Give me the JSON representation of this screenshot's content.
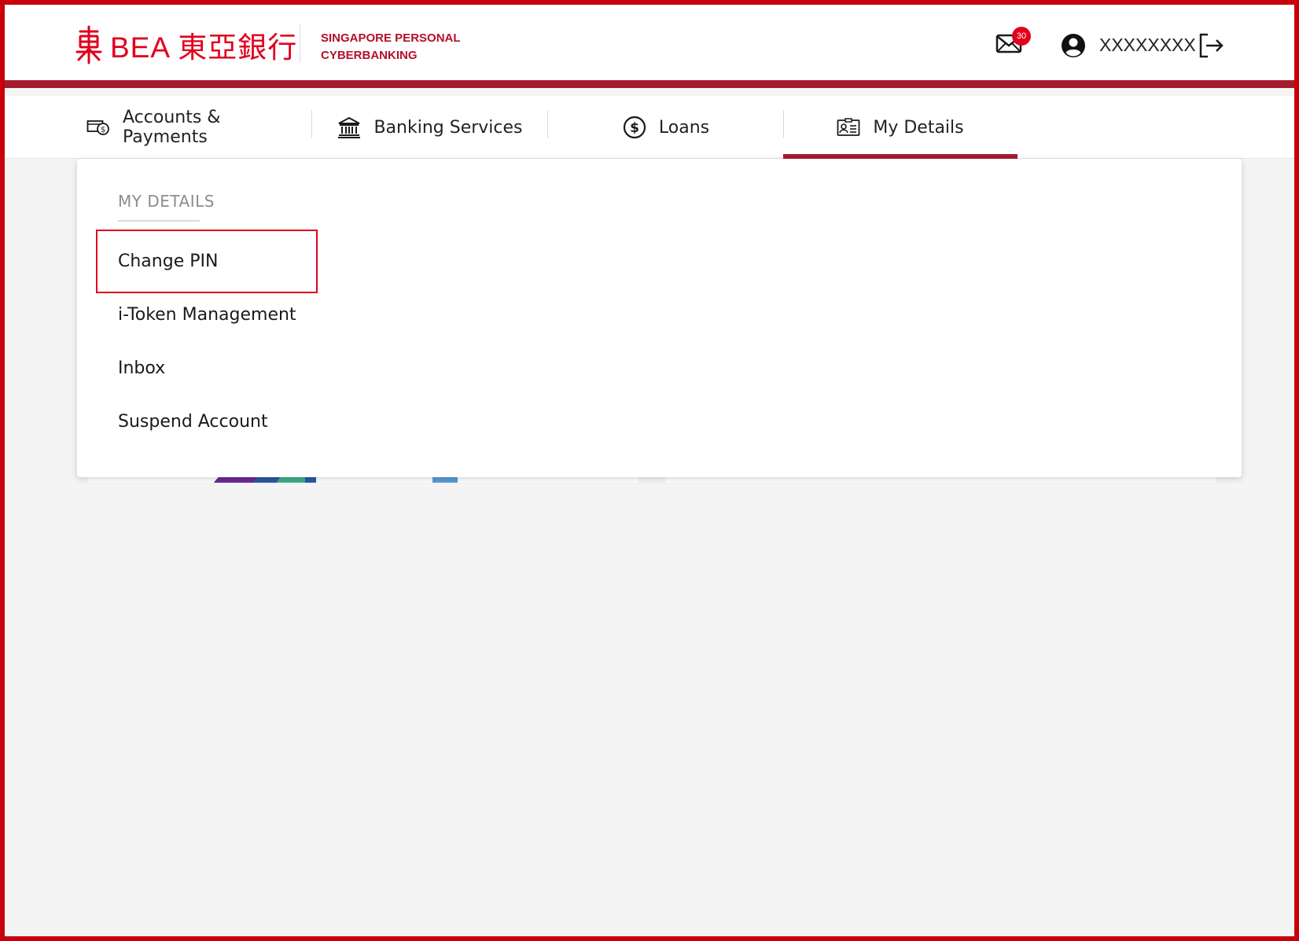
{
  "header": {
    "logo_text": "BEA 東亞銀行",
    "subtitle_line1": "SINGAPORE PERSONAL",
    "subtitle_line2": "CYBERBANKING",
    "mail_badge": "30",
    "user_name": "XXXXXXXX"
  },
  "nav": {
    "tabs": [
      {
        "label": "Accounts & Payments",
        "icon": "cash-payment-icon"
      },
      {
        "label": "Banking Services",
        "icon": "bank-building-icon"
      },
      {
        "label": "Loans",
        "icon": "dollar-circle-icon"
      },
      {
        "label": "My Details",
        "icon": "id-card-icon",
        "active": true
      }
    ]
  },
  "dropdown": {
    "heading": "MY DETAILS",
    "items": [
      {
        "label": "Change PIN",
        "highlighted": true
      },
      {
        "label": "i-Token Management"
      },
      {
        "label": "Inbox"
      },
      {
        "label": "Suspend Account"
      }
    ]
  },
  "colors": {
    "brand_red": "#e1001e",
    "bar_maroon": "#a51d2d",
    "frame_red": "#c8000b",
    "page_bg": "#f4f4f4"
  }
}
